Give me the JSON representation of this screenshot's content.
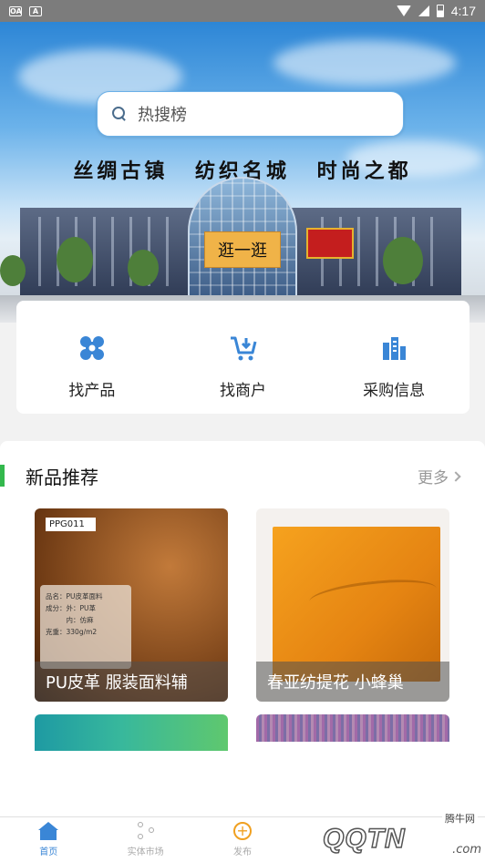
{
  "status_bar": {
    "time": "4:17",
    "left_icons": [
      "OA",
      "A"
    ]
  },
  "banner": {
    "search_placeholder": "热搜榜",
    "slogan": "丝绸古镇 纺织名城 时尚之都",
    "stroll_label": "逛一逛"
  },
  "quick_links": [
    {
      "label": "找产品",
      "icon": "product-grid-icon"
    },
    {
      "label": "找商户",
      "icon": "cart-icon"
    },
    {
      "label": "采购信息",
      "icon": "buildings-icon"
    }
  ],
  "new_products": {
    "title": "新品推荐",
    "more_label": "更多",
    "items": [
      {
        "caption": "PU皮革 服装面料辅",
        "tag": "PPG011",
        "sheet_lines": [
          "品名：PU皮革面料",
          "成分：外：PU革",
          "　　　内：仿麻",
          "克重：330g/m2"
        ]
      },
      {
        "caption": "春亚纺提花 小蜂巢"
      },
      {
        "caption": ""
      },
      {
        "caption": ""
      }
    ]
  },
  "tab_bar": {
    "tabs": [
      {
        "label": "首页",
        "active": true,
        "icon": "home-icon"
      },
      {
        "label": "实体市场",
        "active": false,
        "icon": "network-icon"
      },
      {
        "label": "发布",
        "active": false,
        "icon": "plus-circle-icon"
      },
      {
        "label": "",
        "active": false,
        "icon": "message-icon"
      },
      {
        "label": "",
        "active": false,
        "icon": "user-icon"
      }
    ]
  },
  "watermark": {
    "text": "QQTN",
    "tag": "腾牛网",
    "suffix": ".com"
  },
  "colors": {
    "accent_blue": "#3a86d6",
    "green_bar": "#33b84d",
    "orange_button": "#f0b348"
  }
}
